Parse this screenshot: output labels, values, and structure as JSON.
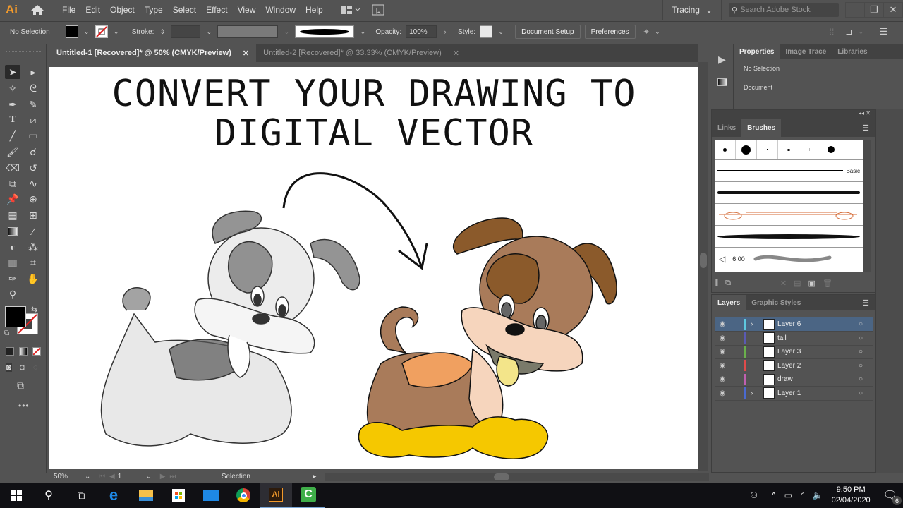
{
  "app": {
    "logo": "Ai"
  },
  "menu": {
    "items": [
      "File",
      "Edit",
      "Object",
      "Type",
      "Select",
      "Effect",
      "View",
      "Window",
      "Help"
    ],
    "workspace": "Tracing",
    "search_placeholder": "Search Adobe Stock"
  },
  "window_controls": {
    "minimize": "—",
    "restore": "❐",
    "close": "✕"
  },
  "controlbar": {
    "selection": "No Selection",
    "stroke_label": "Stroke:",
    "opacity_label": "Opacity:",
    "opacity_value": "100%",
    "style_label": "Style:",
    "document_setup": "Document Setup",
    "preferences": "Preferences"
  },
  "tabs": [
    {
      "label": "Untitled-1 [Recovered]* @ 50% (CMYK/Preview)",
      "active": true
    },
    {
      "label": "Untitled-2 [Recovered]* @ 33.33% (CMYK/Preview)",
      "active": false
    }
  ],
  "artboard": {
    "headline_line1": "CONVERT YOUR DRAWING TO",
    "headline_line2": "DIGITAL VECTOR",
    "colors": {
      "body": "#a97b5a",
      "dark_brown": "#8b5a2b",
      "saddle": "#f0a060",
      "muzzle": "#f6d5bd",
      "feet": "#f5c800",
      "tongue": "#f3e58a",
      "mouth": "#7a7a6a"
    }
  },
  "statusbar": {
    "zoom": "50%",
    "artboard_num": "1",
    "tool": "Selection"
  },
  "properties_panel": {
    "tabs": [
      "Properties",
      "Image Trace",
      "Libraries"
    ],
    "selection": "No Selection",
    "section": "Document"
  },
  "brushes_panel": {
    "tabs": [
      "Links",
      "Brushes"
    ],
    "basic_label": "Basic",
    "size_value": "6.00"
  },
  "layers_panel": {
    "tabs": [
      "Layers",
      "Graphic Styles"
    ],
    "layers": [
      {
        "name": "Layer 6",
        "color": "#5ec8e0",
        "expandable": true,
        "selected": true
      },
      {
        "name": "tail",
        "color": "#5a5ab4",
        "expandable": false,
        "selected": false
      },
      {
        "name": "Layer 3",
        "color": "#6ab04c",
        "expandable": false,
        "selected": false
      },
      {
        "name": "Layer 2",
        "color": "#e04b4b",
        "expandable": false,
        "selected": false
      },
      {
        "name": "draw",
        "color": "#c060b0",
        "expandable": false,
        "selected": false
      },
      {
        "name": "Layer 1",
        "color": "#4a6ad0",
        "expandable": true,
        "selected": false
      }
    ]
  },
  "taskbar": {
    "time": "9:50 PM",
    "date": "02/04/2020",
    "notification_count": "6"
  }
}
